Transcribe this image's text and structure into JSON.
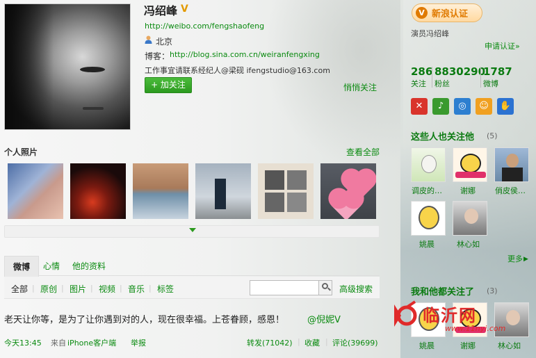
{
  "profile": {
    "name": "冯绍峰",
    "weibo_url": "http://weibo.com/fengshaofeng",
    "location": "北京",
    "blog_label": "博客：",
    "blog_url": "http://blog.sina.com.cn/weiranfengxing",
    "contact": "工作事宜请联系经纪人@梁砚 ifengstudio@163.com",
    "follow_button": "+ 加关注",
    "quiet_follow": "悄悄关注"
  },
  "photos": {
    "title": "个人照片",
    "view_all": "查看全部"
  },
  "tabs": {
    "weibo": "微博",
    "mood": "心情",
    "profile": "他的资料"
  },
  "filters": {
    "all": "全部",
    "original": "原创",
    "images": "图片",
    "videos": "视频",
    "music": "音乐",
    "tags": "标签",
    "search_placeholder": "",
    "advanced_search": "高级搜索"
  },
  "post": {
    "text": "老天让你等，是为了让你遇到对的人，现在很幸福。上苍眷顾，感恩！",
    "mention": "@倪妮V",
    "time": "今天13:45",
    "from": "来自",
    "client": "iPhone客户端",
    "report": "举报",
    "repost": "转发(71042)",
    "favorite": "收藏",
    "comment": "评论(39699)"
  },
  "sidebar": {
    "verify_badge": "新浪认证",
    "verify_desc": "演员冯绍峰",
    "apply_verify": "申请认证»",
    "stats": [
      {
        "num": "286",
        "label": "关注"
      },
      {
        "num": "8830290",
        "label": "粉丝"
      },
      {
        "num": "1787",
        "label": "微博"
      }
    ],
    "follow_also_title": "这些人也关注他",
    "follow_also_count": "(5)",
    "follow_also_users": [
      "调皮的…",
      "谢娜",
      "俏皮侯…",
      "姚晨",
      "林心如"
    ],
    "more": "更多",
    "mutual_title": "我和他都关注了",
    "mutual_count": "(3)",
    "mutual_users": [
      "姚晨",
      "谢娜",
      "林心如"
    ]
  },
  "watermark": {
    "brand": "临沂网",
    "url": "www.11nyi.com"
  },
  "colors": {
    "accent_green": "#0a8a10",
    "button_green": "#2c9a1f",
    "verify_orange": "#e07a00",
    "watermark_red": "#e02a2a"
  }
}
